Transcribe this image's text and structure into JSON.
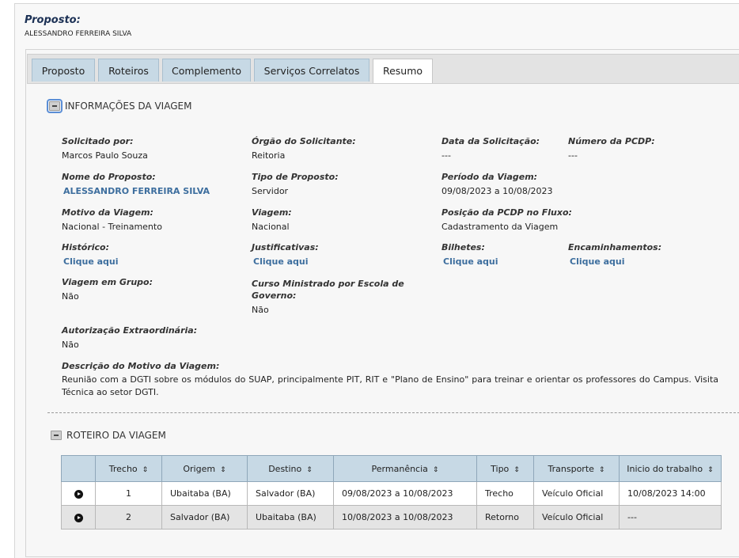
{
  "header": {
    "title": "Proposto:",
    "name": "ALESSANDRO FERREIRA SILVA"
  },
  "tabs": [
    {
      "label": "Proposto"
    },
    {
      "label": "Roteiros"
    },
    {
      "label": "Complemento"
    },
    {
      "label": "Serviços Correlatos"
    },
    {
      "label": "Resumo",
      "active": true
    }
  ],
  "info": {
    "title": "INFORMAÇÕES DA VIAGEM",
    "solicitado_por": {
      "label": "Solicitado por:",
      "value": "Marcos Paulo Souza"
    },
    "orgao": {
      "label": "Órgão do Solicitante:",
      "value": "Reitoria"
    },
    "data_solicitacao": {
      "label": "Data da Solicitação:",
      "value": "---"
    },
    "numero_pcdp": {
      "label": "Número da PCDP:",
      "value": "---"
    },
    "nome_proposto": {
      "label": "Nome do Proposto:",
      "value": "ALESSANDRO FERREIRA SILVA"
    },
    "tipo_proposto": {
      "label": "Tipo de Proposto:",
      "value": "Servidor"
    },
    "periodo": {
      "label": "Período da Viagem:",
      "value": "09/08/2023 a 10/08/2023"
    },
    "motivo": {
      "label": "Motivo da Viagem:",
      "value": "Nacional - Treinamento"
    },
    "viagem": {
      "label": "Viagem:",
      "value": "Nacional"
    },
    "posicao": {
      "label": "Posição da PCDP no Fluxo:",
      "value": "Cadastramento da Viagem"
    },
    "historico": {
      "label": "Histórico:",
      "link": "Clique aqui"
    },
    "justificativas": {
      "label": "Justificativas:",
      "link": "Clique aqui"
    },
    "bilhetes": {
      "label": "Bilhetes:",
      "link": "Clique aqui"
    },
    "encaminhamentos": {
      "label": "Encaminhamentos:",
      "link": "Clique aqui"
    },
    "grupo": {
      "label": "Viagem em Grupo:",
      "value": "Não"
    },
    "curso": {
      "label_line1": "Curso Ministrado por Escola de",
      "label_line2": "Governo:",
      "value": "Não"
    },
    "autorizacao": {
      "label": "Autorização Extraordinária:",
      "value": "Não"
    },
    "descricao": {
      "label": "Descrição do Motivo da Viagem:",
      "value": "Reunião com a DGTI sobre os módulos do SUAP, principalmente PIT, RIT e \"Plano de Ensino\" para treinar e orientar os professores do Campus. Visita Técnica ao setor DGTI."
    }
  },
  "roteiro": {
    "title": "ROTEIRO DA VIAGEM",
    "columns": [
      "Trecho",
      "Origem",
      "Destino",
      "Permanência",
      "Tipo",
      "Transporte",
      "Inicio do trabalho"
    ],
    "rows": [
      {
        "trecho": "1",
        "origem": "Ubaitaba (BA)",
        "destino": "Salvador (BA)",
        "permanencia": "09/08/2023 a 10/08/2023",
        "tipo": "Trecho",
        "transporte": "Veículo Oficial",
        "inicio": "10/08/2023 14:00"
      },
      {
        "trecho": "2",
        "origem": "Salvador (BA)",
        "destino": "Ubaitaba (BA)",
        "permanencia": "10/08/2023 a 10/08/2023",
        "tipo": "Retorno",
        "transporte": "Veículo Oficial",
        "inicio": "---"
      }
    ]
  },
  "colors": {
    "tab_bg": "#c7d9e5",
    "link": "#3d6e9e",
    "title": "#1c3155"
  }
}
